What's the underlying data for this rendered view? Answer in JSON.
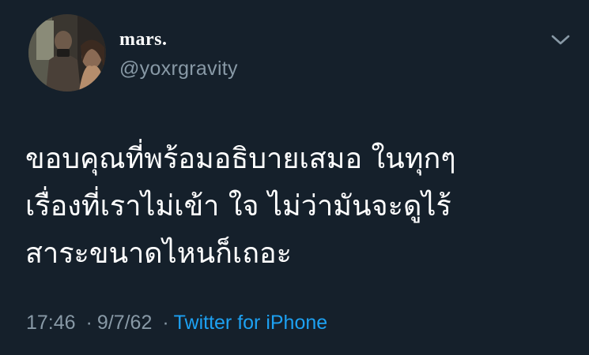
{
  "author": {
    "display_name": "mars.",
    "handle": "@yoxrgravity"
  },
  "tweet": {
    "lines": [
      "ขอบคุณที่พร้อมอธิบายเสมอ ในทุกๆ",
      "เรื่องที่เราไม่เข้า ใจ ไม่ว่ามันจะดูไร้",
      "สาระขนาดไหนก็เถอะ"
    ],
    "time": "17:46",
    "separator": "·",
    "date": "9/7/62",
    "source": "Twitter for iPhone"
  },
  "icons": {
    "menu": "chevron-down-icon"
  },
  "colors": {
    "background": "#15202b",
    "primary_text": "#ffffff",
    "secondary_text": "#8899a6",
    "link": "#1da1f2"
  }
}
